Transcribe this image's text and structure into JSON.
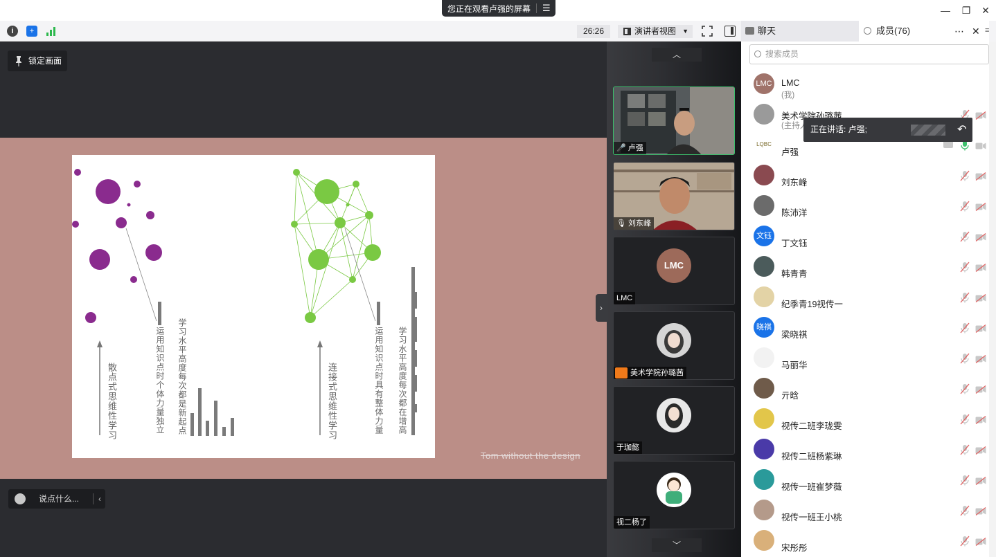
{
  "title_bar": {
    "share_banner": "您正在观看卢强的屏幕"
  },
  "toolbar": {
    "timer": "26:26",
    "view_mode": "演讲者视图"
  },
  "side_tabs": {
    "chat": "聊天",
    "members": "成员(76)"
  },
  "stage": {
    "lock_label": "锁定画面",
    "chat_placeholder": "说点什么...",
    "caption": "Tom without the design"
  },
  "slide": {
    "left_arrow_text": "散点式思维性学习",
    "left_col1": "运用知识点时个体力量独立",
    "left_col2": "学习水平高度每次都是新起点",
    "right_arrow_text": "连接式思维性学习",
    "right_col1": "运用知识点时具有整体力量",
    "right_col2": "学习水平高度每次都在增高",
    "colors": {
      "purple": "#8a2b8e",
      "green": "#7ac943",
      "bar": "#7a7a7a"
    }
  },
  "videos": [
    {
      "name": "卢强",
      "active": true
    },
    {
      "name": "刘东峰",
      "active": false
    },
    {
      "name": "LMC",
      "active": false
    },
    {
      "name": "美术学院孙璐茜",
      "active": false
    },
    {
      "name": "于珈懿",
      "active": false
    },
    {
      "name": "视二杨了",
      "active": false
    }
  ],
  "members": {
    "search_placeholder": "搜索成员",
    "speaking_tip": "正在讲话: 卢强;",
    "list": [
      {
        "name": "LMC",
        "sub": "(我)",
        "avatar_color": "#a0736a",
        "avatar_text": "LMC"
      },
      {
        "name": "美术学院孙璐茜",
        "sub": "(主持人)",
        "avatar_color": "#9a9a9a",
        "avatar_text": ""
      },
      {
        "name": "卢强",
        "sub": "",
        "avatar_color": "#ffffff",
        "avatar_text": "LQBC"
      },
      {
        "name": "刘东峰",
        "sub": "",
        "avatar_color": "#8a4a50",
        "avatar_text": ""
      },
      {
        "name": "陈沛洋",
        "sub": "",
        "avatar_color": "#6b6b6b",
        "avatar_text": ""
      },
      {
        "name": "丁文钰",
        "sub": "",
        "avatar_color": "#1a73e8",
        "avatar_text": "文钰"
      },
      {
        "name": "韩青青",
        "sub": "",
        "avatar_color": "#4b5b5b",
        "avatar_text": ""
      },
      {
        "name": "纪季青19视传一",
        "sub": "",
        "avatar_color": "#e3d3a6",
        "avatar_text": ""
      },
      {
        "name": "梁晓祺",
        "sub": "",
        "avatar_color": "#1a73e8",
        "avatar_text": "晓祺"
      },
      {
        "name": "马丽华",
        "sub": "",
        "avatar_color": "#f2f2f2",
        "avatar_text": ""
      },
      {
        "name": "亓晗",
        "sub": "",
        "avatar_color": "#6f5b4a",
        "avatar_text": ""
      },
      {
        "name": "视传二班李珑雯",
        "sub": "",
        "avatar_color": "#e2c64a",
        "avatar_text": ""
      },
      {
        "name": "视传二班杨紫琳",
        "sub": "",
        "avatar_color": "#4a3aa8",
        "avatar_text": ""
      },
      {
        "name": "视传一班崔梦薇",
        "sub": "",
        "avatar_color": "#2a9a9a",
        "avatar_text": ""
      },
      {
        "name": "视传一班王小桃",
        "sub": "",
        "avatar_color": "#b49a8a",
        "avatar_text": ""
      },
      {
        "name": "宋彤彤",
        "sub": "",
        "avatar_color": "#d9b07a",
        "avatar_text": ""
      }
    ]
  }
}
